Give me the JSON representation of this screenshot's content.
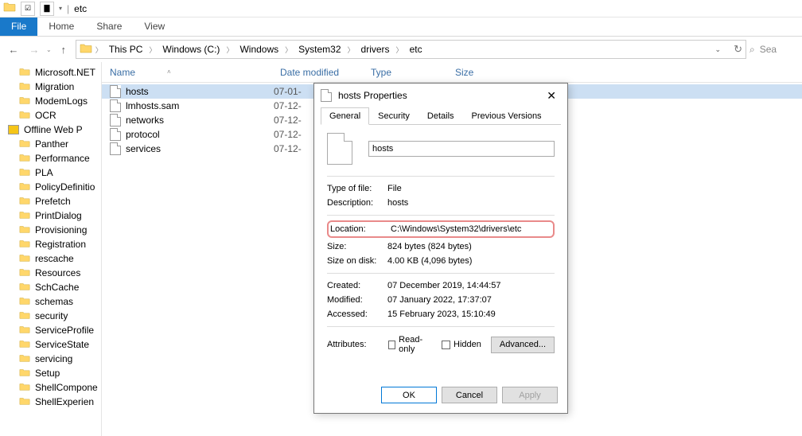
{
  "titlebar": {
    "title": "etc"
  },
  "ribbon": {
    "tabs": [
      "File",
      "Home",
      "Share",
      "View"
    ]
  },
  "breadcrumb": {
    "parts": [
      "This PC",
      "Windows (C:)",
      "Windows",
      "System32",
      "drivers",
      "etc"
    ]
  },
  "search": {
    "placeholder": "Sea"
  },
  "sidebar": {
    "items": [
      {
        "label": "Microsoft.NET",
        "type": "folder"
      },
      {
        "label": "Migration",
        "type": "folder"
      },
      {
        "label": "ModemLogs",
        "type": "folder"
      },
      {
        "label": "OCR",
        "type": "folder"
      },
      {
        "label": "Offline Web P",
        "type": "offline"
      },
      {
        "label": "Panther",
        "type": "folder"
      },
      {
        "label": "Performance",
        "type": "folder"
      },
      {
        "label": "PLA",
        "type": "folder"
      },
      {
        "label": "PolicyDefinitio",
        "type": "folder"
      },
      {
        "label": "Prefetch",
        "type": "folder"
      },
      {
        "label": "PrintDialog",
        "type": "folder"
      },
      {
        "label": "Provisioning",
        "type": "folder"
      },
      {
        "label": "Registration",
        "type": "folder"
      },
      {
        "label": "rescache",
        "type": "folder"
      },
      {
        "label": "Resources",
        "type": "folder"
      },
      {
        "label": "SchCache",
        "type": "folder"
      },
      {
        "label": "schemas",
        "type": "folder"
      },
      {
        "label": "security",
        "type": "folder"
      },
      {
        "label": "ServiceProfile",
        "type": "folder"
      },
      {
        "label": "ServiceState",
        "type": "folder"
      },
      {
        "label": "servicing",
        "type": "folder"
      },
      {
        "label": "Setup",
        "type": "folder"
      },
      {
        "label": "ShellCompone",
        "type": "folder"
      },
      {
        "label": "ShellExperien",
        "type": "folder"
      }
    ]
  },
  "columns": {
    "name": "Name",
    "date": "Date modified",
    "type": "Type",
    "size": "Size"
  },
  "files": [
    {
      "name": "hosts",
      "date": "07-01-",
      "selected": true
    },
    {
      "name": "lmhosts.sam",
      "date": "07-12-",
      "selected": false
    },
    {
      "name": "networks",
      "date": "07-12-",
      "selected": false
    },
    {
      "name": "protocol",
      "date": "07-12-",
      "selected": false
    },
    {
      "name": "services",
      "date": "07-12-",
      "selected": false
    }
  ],
  "dialog": {
    "title": "hosts Properties",
    "tabs": [
      "General",
      "Security",
      "Details",
      "Previous Versions"
    ],
    "filename": "hosts",
    "rows": {
      "typeLabel": "Type of file:",
      "typeValue": "File",
      "descLabel": "Description:",
      "descValue": "hosts",
      "locLabel": "Location:",
      "locValue": "C:\\Windows\\System32\\drivers\\etc",
      "sizeLabel": "Size:",
      "sizeValue": "824 bytes (824 bytes)",
      "diskLabel": "Size on disk:",
      "diskValue": "4.00 KB (4,096 bytes)",
      "createdLabel": "Created:",
      "createdValue": "07 December 2019, 14:44:57",
      "modifiedLabel": "Modified:",
      "modifiedValue": "07 January 2022, 17:37:07",
      "accessedLabel": "Accessed:",
      "accessedValue": "15 February 2023, 15:10:49",
      "attrLabel": "Attributes:",
      "readonly": "Read-only",
      "hidden": "Hidden",
      "advanced": "Advanced..."
    },
    "buttons": {
      "ok": "OK",
      "cancel": "Cancel",
      "apply": "Apply"
    }
  }
}
